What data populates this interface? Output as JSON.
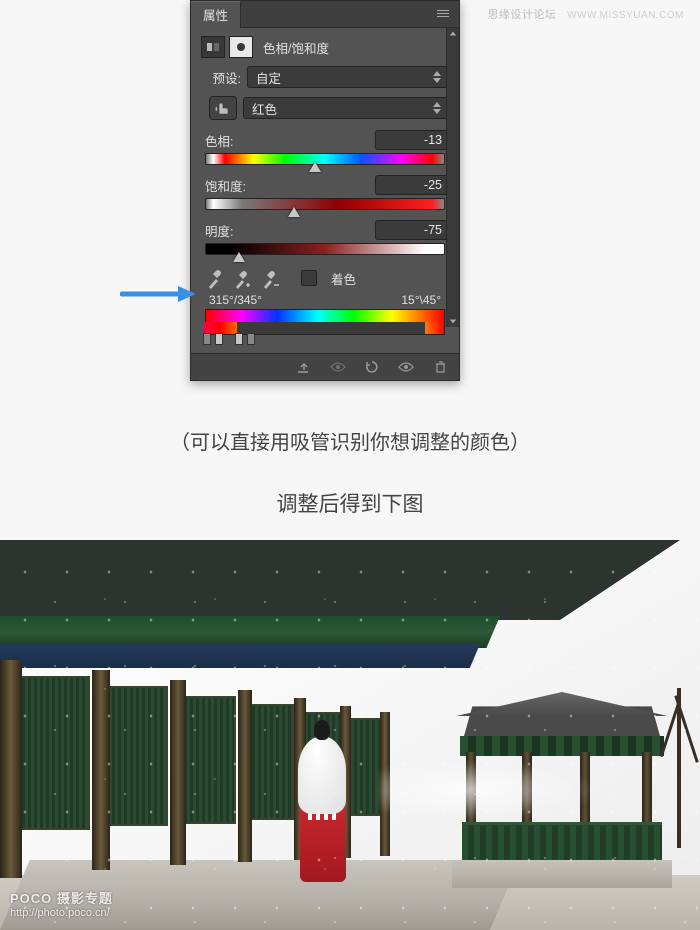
{
  "page": {
    "top_right_brand": "思缘设计论坛",
    "top_right_url": "WWW.MISSYUAN.COM",
    "caption1": "（可以直接用吸管识别你想调整的颜色）",
    "caption2": "调整后得到下图"
  },
  "panel": {
    "tab": "属性",
    "adjustment_label": "色相/饱和度",
    "watermark_line": "http://photo.poco.cn/",
    "preset_label": "预设:",
    "preset_value": "自定",
    "channel_value": "红色",
    "hue_label": "色相:",
    "hue_value": "-13",
    "sat_label": "饱和度:",
    "sat_value": "-25",
    "light_label": "明度:",
    "light_value": "-75",
    "colorize_label": "着色",
    "range_left": "315°/345°",
    "range_right": "15°\\45°",
    "slider_positions": {
      "hue_pct": 46,
      "sat_pct": 37,
      "light_pct": 14
    }
  },
  "photo": {
    "watermark_title": "POCO 摄影专题",
    "watermark_url": "http://photo.poco.cn/"
  }
}
